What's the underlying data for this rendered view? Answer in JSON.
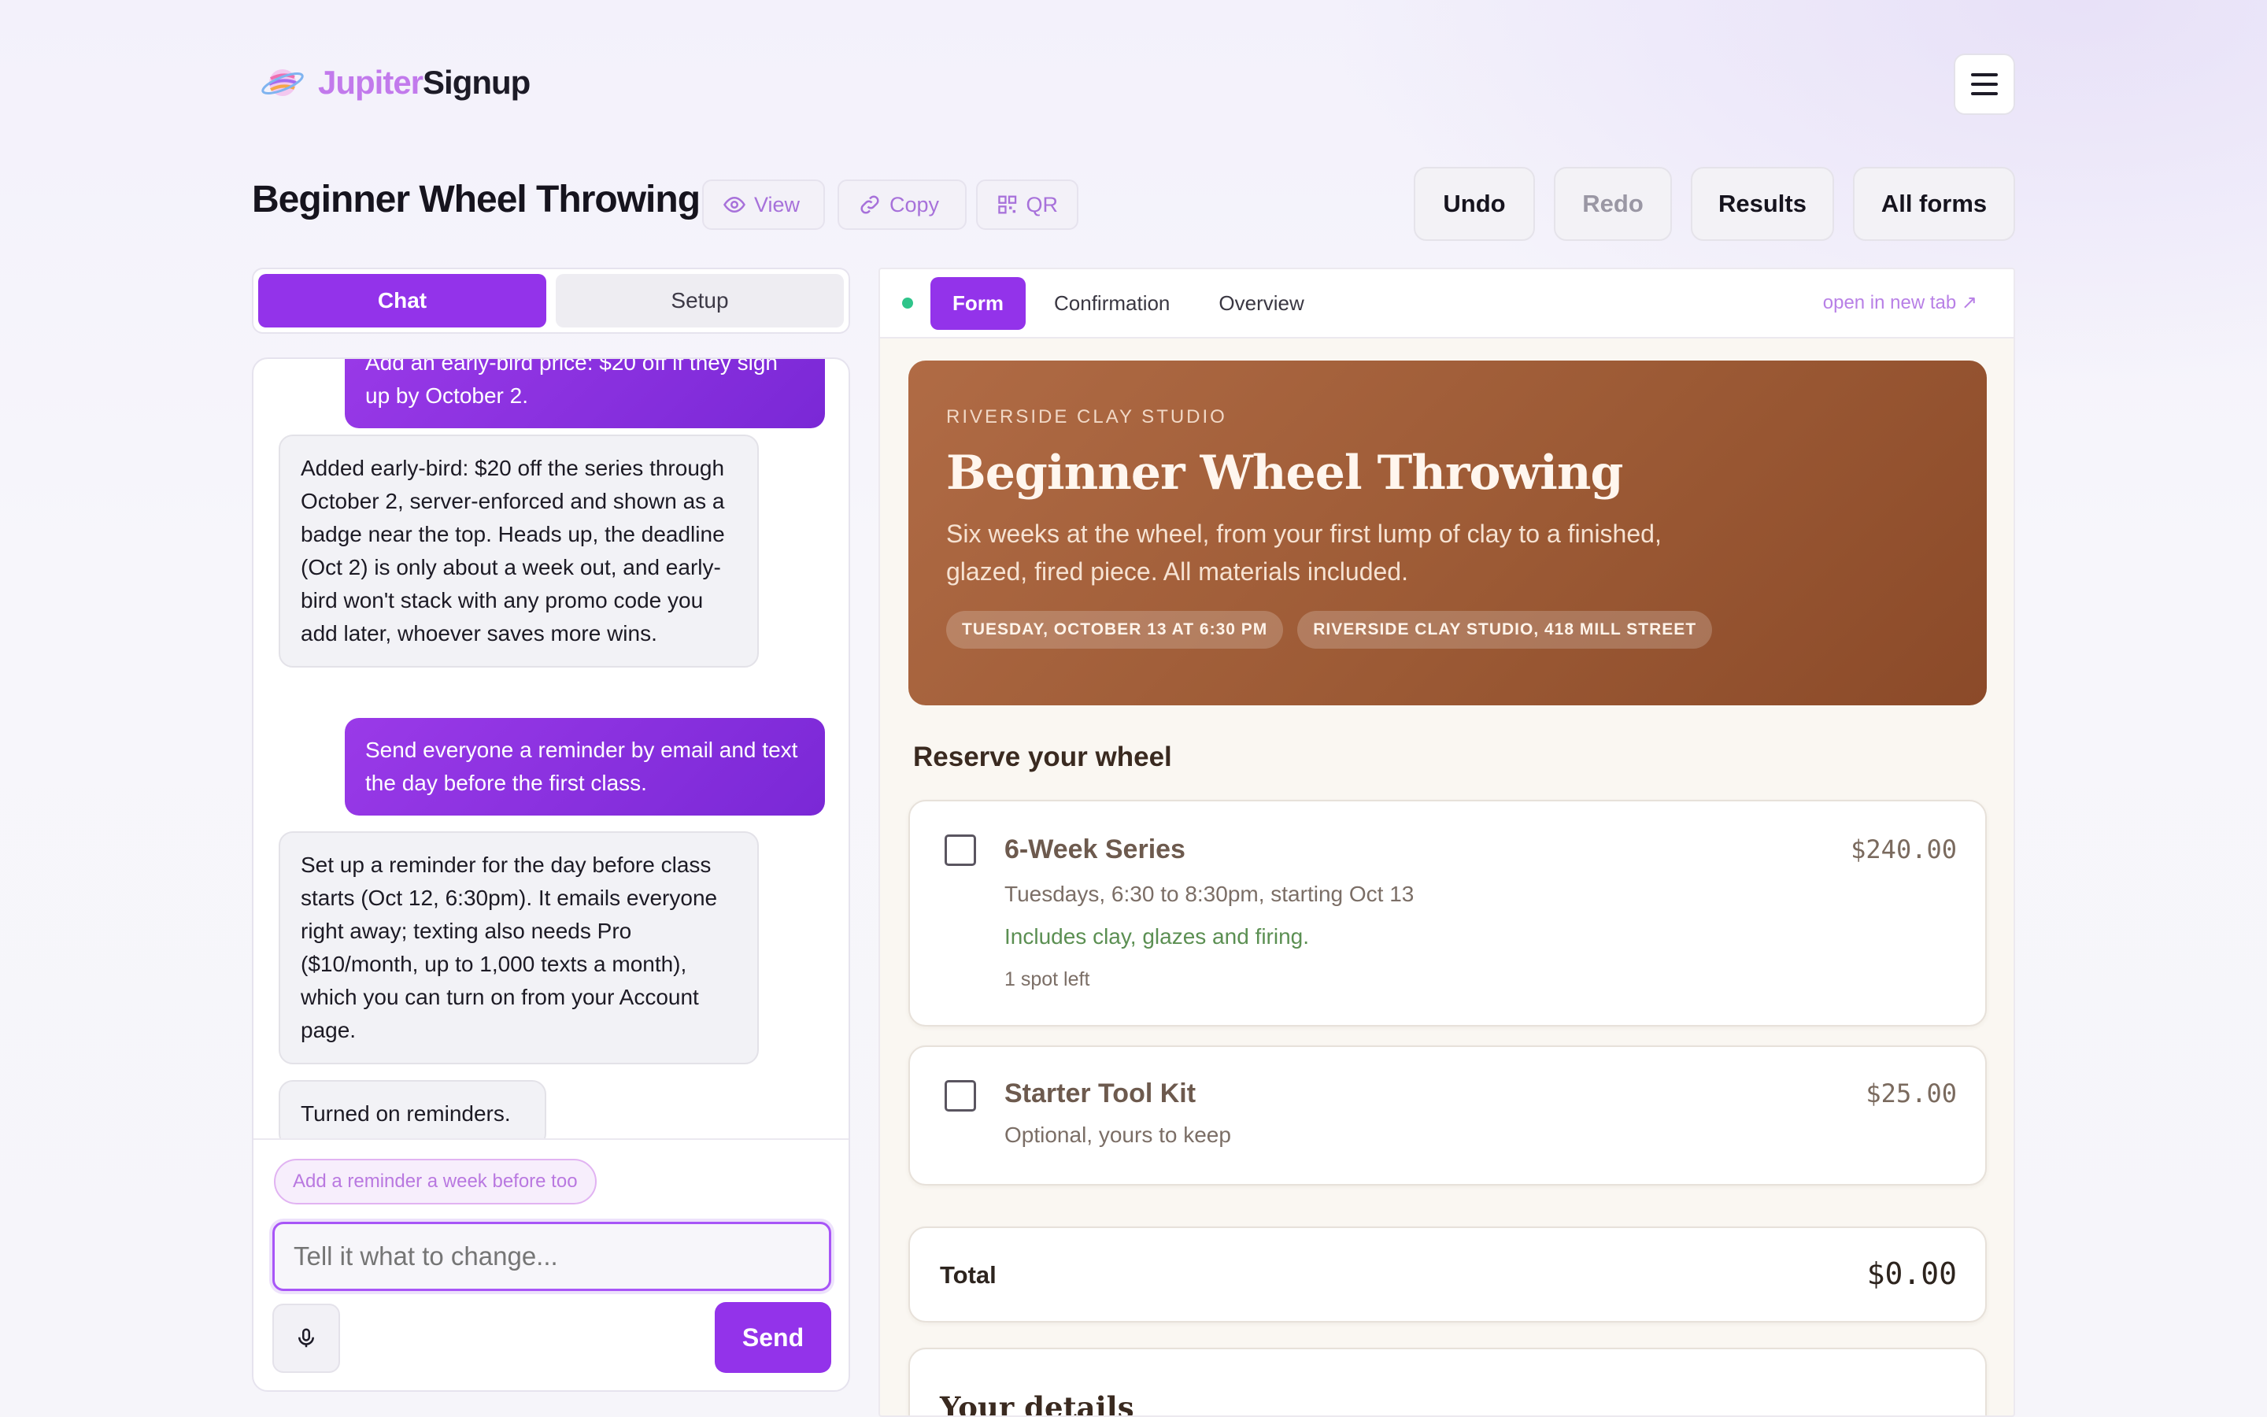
{
  "app": {
    "name_part1": "Jupiter",
    "name_part2": "Signup"
  },
  "header": {
    "form_title": "Beginner Wheel Throwing",
    "view_label": "View",
    "copy_label": "Copy",
    "qr_label": "QR",
    "undo_label": "Undo",
    "redo_label": "Redo",
    "results_label": "Results",
    "all_forms_label": "All forms"
  },
  "left_tabs": {
    "chat": "Chat",
    "setup": "Setup"
  },
  "chat": {
    "messages": [
      {
        "role": "user",
        "text": "Add an early-bird price: $20 off if they sign up by October 2."
      },
      {
        "role": "assistant",
        "text": "Added early-bird: $20 off the series through October 2, server-enforced and shown as a badge near the top. Heads up, the deadline (Oct 2) is only about a week out, and early-bird won't stack with any promo code you add later, whoever saves more wins."
      },
      {
        "role": "user",
        "text": "Send everyone a reminder by email and text the day before the first class."
      },
      {
        "role": "assistant",
        "text": "Set up a reminder for the day before class starts (Oct 12, 6:30pm). It emails everyone right away; texting also needs Pro ($10/month, up to 1,000 texts a month), which you can turn on from your Account page."
      },
      {
        "role": "assistant",
        "text": "Turned on reminders."
      }
    ],
    "suggestion": "Add a reminder a week before too",
    "input_placeholder": "Tell it what to change...",
    "send_label": "Send"
  },
  "preview": {
    "tabs": [
      "Form",
      "Confirmation",
      "Overview"
    ],
    "open_new_tab": "open in new tab",
    "status_color": "#2fc48a"
  },
  "form": {
    "org": "RIVERSIDE CLAY STUDIO",
    "title": "Beginner Wheel Throwing",
    "description": "Six weeks at the wheel, from your first lump of clay to a finished, glazed, fired piece. All materials included.",
    "chips": [
      "TUESDAY, OCTOBER 13 AT 6:30 PM",
      "RIVERSIDE CLAY STUDIO, 418 MILL STREET"
    ],
    "section_title": "Reserve your wheel",
    "items": [
      {
        "name": "6-Week Series",
        "price": "$240.00",
        "line1": "Tuesdays, 6:30 to 8:30pm, starting Oct 13",
        "line2": "Includes clay, glazes and firing.",
        "line3": "1 spot left",
        "checked": false
      },
      {
        "name": "Starter Tool Kit",
        "price": "$25.00",
        "line1": "Optional, yours to keep",
        "checked": false
      }
    ],
    "total_label": "Total",
    "total_value": "$0.00",
    "details_title": "Your details"
  },
  "colors": {
    "accent": "#9333ea",
    "hero": "#9c5a35"
  }
}
